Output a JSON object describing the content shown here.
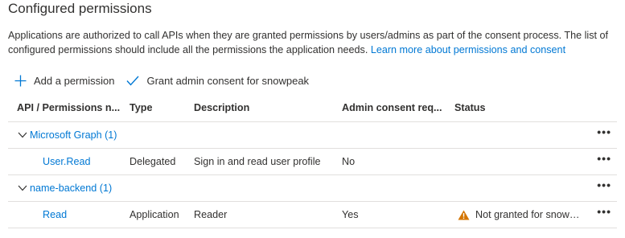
{
  "section": {
    "title": "Configured permissions",
    "description": "Applications are authorized to call APIs when they are granted permissions by users/admins as part of the consent process. The list of configured permissions should include all the permissions the application needs.",
    "learn_more": "Learn more about permissions and consent"
  },
  "toolbar": {
    "add_label": "Add a permission",
    "grant_label": "Grant admin consent for snowpeak"
  },
  "table": {
    "headers": [
      "API / Permissions n...",
      "Type",
      "Description",
      "Admin consent req...",
      "Status"
    ],
    "groups": [
      {
        "name": "Microsoft Graph (1)",
        "more": "•••",
        "permissions": [
          {
            "name": "User.Read",
            "type": "Delegated",
            "description": "Sign in and read user profile",
            "admin_consent": "No",
            "status": "",
            "more": "•••"
          }
        ]
      },
      {
        "name": "name-backend (1)",
        "more": "•••",
        "permissions": [
          {
            "name": "Read",
            "type": "Application",
            "description": "Reader",
            "admin_consent": "Yes",
            "status": "Not granted for snowpe...",
            "status_icon": "warning-icon",
            "status_color": "#d47500",
            "more": "•••"
          }
        ]
      }
    ]
  },
  "colors": {
    "accent": "#0078d4",
    "text": "#323130",
    "divider": "#e1dfdd",
    "warning": "#d47500"
  }
}
